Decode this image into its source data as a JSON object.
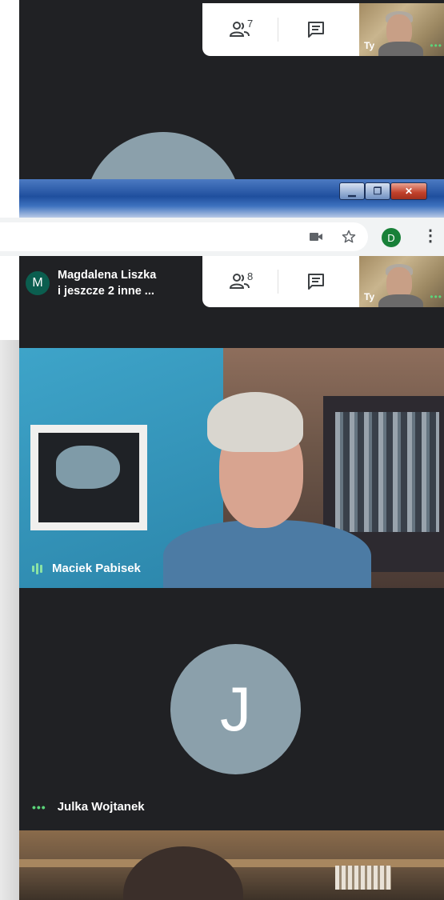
{
  "top_window": {
    "participants_count": "7",
    "self_tile_label": "Ty"
  },
  "titlebar": {
    "min_glyph": "▁",
    "max_glyph": "❐",
    "close_glyph": "✕"
  },
  "browser": {
    "profile_initial": "D"
  },
  "bottom_window": {
    "meeting_avatar_initial": "M",
    "meeting_title_line1": "Magdalena Liszka",
    "meeting_title_line2": "i jeszcze 2 inne ...",
    "participants_count": "8",
    "self_tile_label": "Ty"
  },
  "tiles": [
    {
      "name": "Maciek Pabisek",
      "status": "speaking"
    },
    {
      "name": "Julka Wojtanek",
      "initial": "J",
      "status": "connected"
    }
  ],
  "icons": {
    "people": "people-icon",
    "chat": "chat-icon",
    "camera": "video-camera-icon",
    "star": "star-icon",
    "menu": "more-vert-icon"
  },
  "colors": {
    "meet_bg": "#202124",
    "avatar_bg": "#8ba0ab",
    "profile_bg": "#188038",
    "status_green": "#5bd57a"
  }
}
